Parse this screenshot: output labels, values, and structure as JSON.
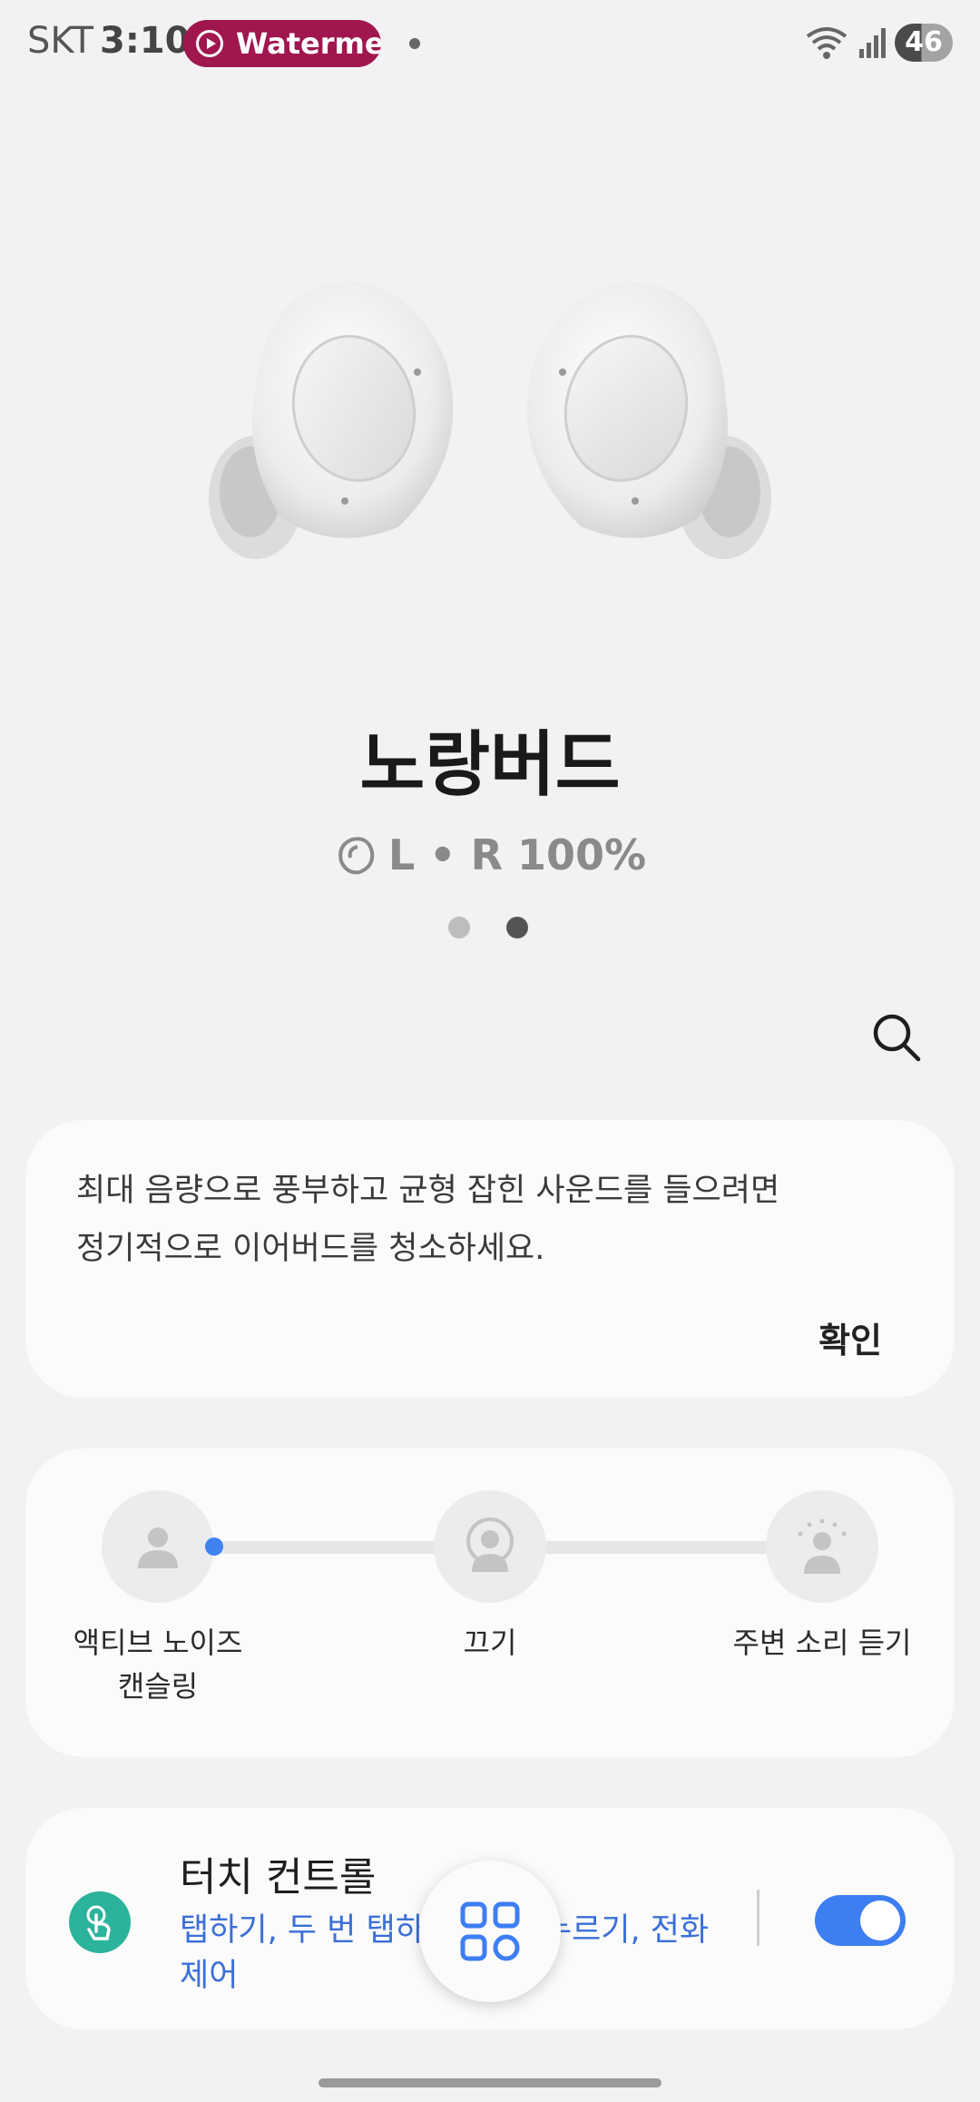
{
  "status_bar": {
    "carrier": "SKT",
    "time": "3:10",
    "recording_label": "Waterme",
    "battery_level": "46"
  },
  "device": {
    "name": "노랑버드",
    "battery_text": "L • R 100%",
    "pages": {
      "count": 2,
      "active": 1
    }
  },
  "tip_card": {
    "text_line1": "최대 음량으로 풍부하고 균형 잡힌 사운드를 들으려면",
    "text_line2": "정기적으로 이어버드를 청소하세요.",
    "confirm_label": "확인"
  },
  "noise_control": {
    "anc_label_line1": "액티브 노이즈",
    "anc_label_line2": "캔슬링",
    "off_label": "끄기",
    "ambient_label": "주변 소리 듣기",
    "selected": "anc"
  },
  "touch_control": {
    "title": "터치 컨트롤",
    "subtitle_line1": "탭하기, 두 번 탭하기, 길게 누르기, 전화",
    "subtitle_line2": "제어",
    "enabled": true
  },
  "colors": {
    "accent": "#3d7ef3",
    "recording_pill": "#a0164f",
    "touch_icon_bg": "#2bb39b",
    "link_text": "#3a6fd8"
  }
}
